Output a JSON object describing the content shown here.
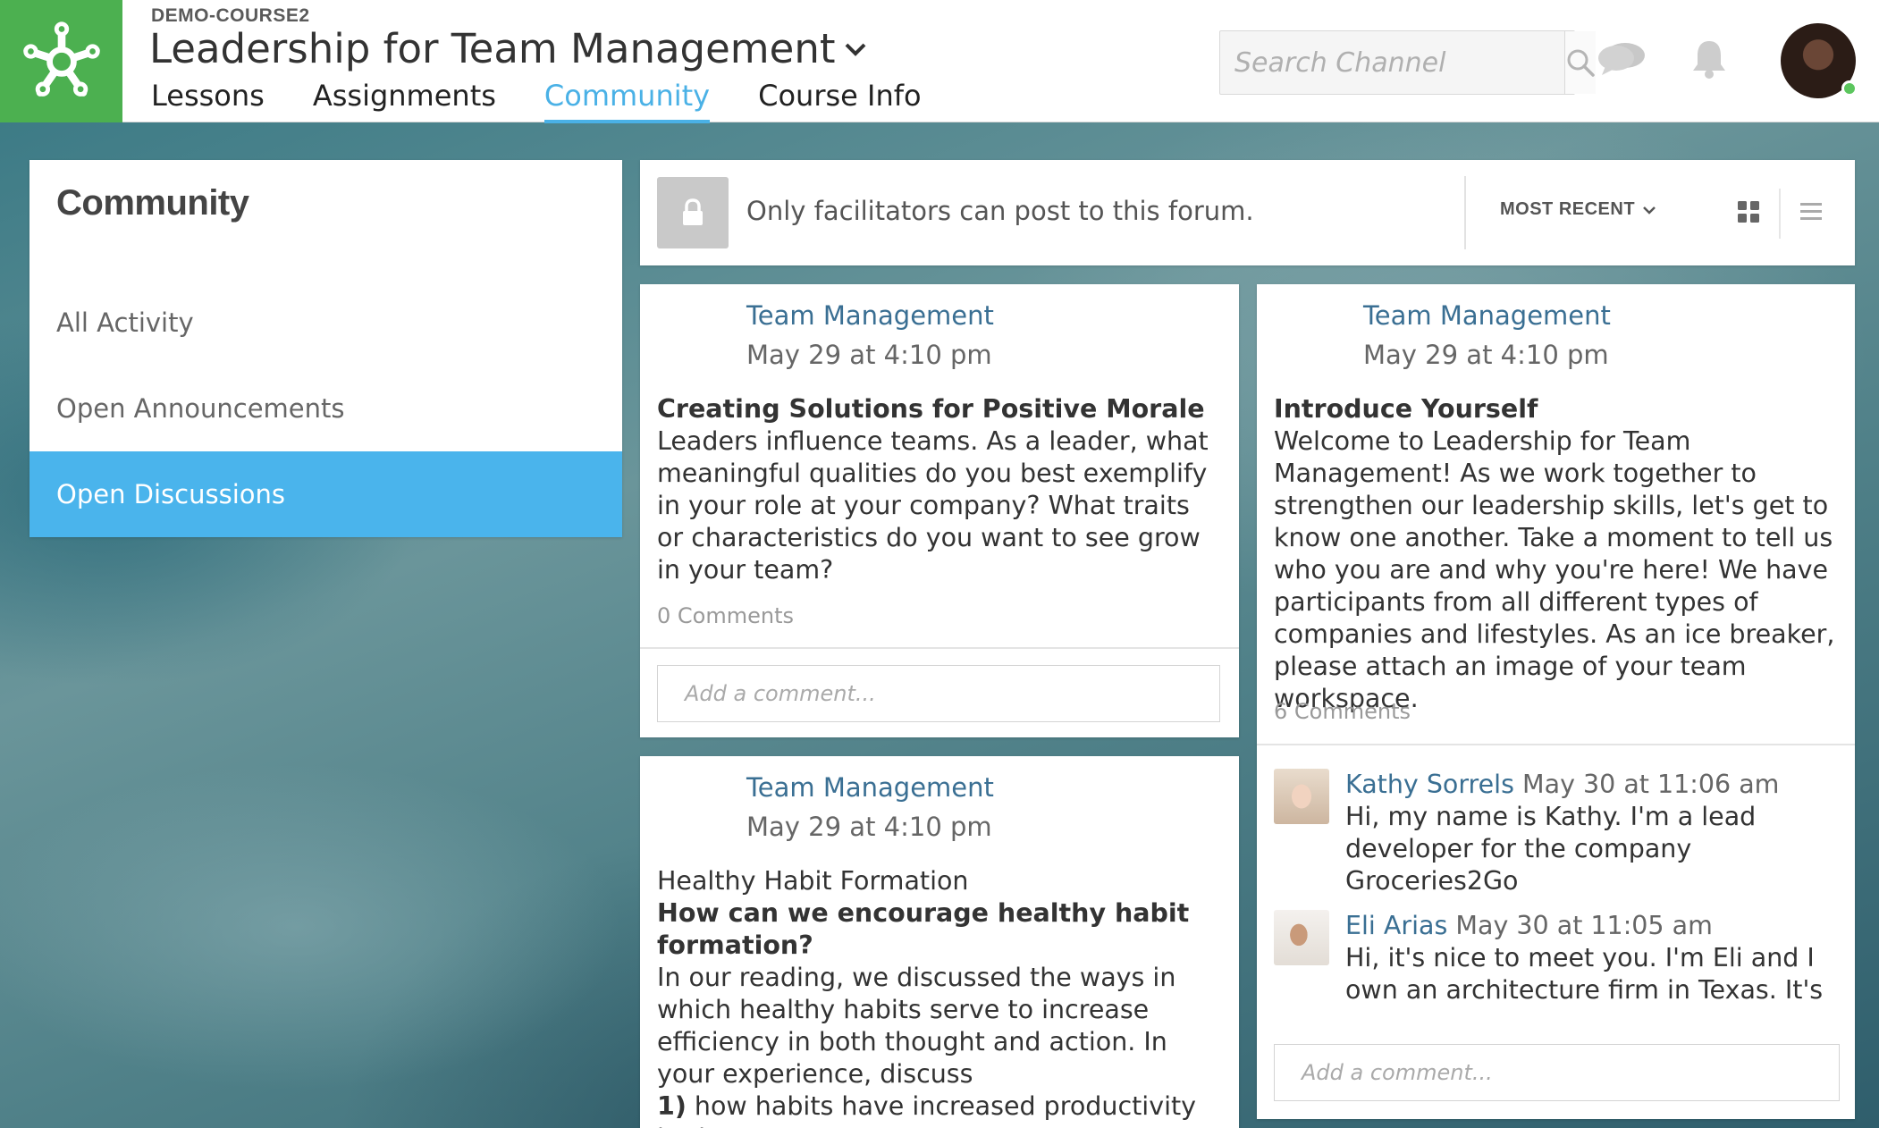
{
  "header": {
    "course_code": "DEMO-COURSE2",
    "course_title": "Leadership for Team Management",
    "nav": [
      {
        "label": "Lessons"
      },
      {
        "label": "Assignments"
      },
      {
        "label": "Community"
      },
      {
        "label": "Course Info"
      }
    ],
    "active_nav": "Community",
    "search_placeholder": "Search Channel"
  },
  "sidebar": {
    "title": "Community",
    "items": [
      {
        "label": "All Activity"
      },
      {
        "label": "Open Announcements"
      },
      {
        "label": "Open Discussions"
      }
    ],
    "active_item": "Open Discussions"
  },
  "topbar": {
    "notice": "Only facilitators can post to this forum.",
    "sort_label": "MOST RECENT"
  },
  "posts": [
    {
      "author": "Team Management",
      "date": "May 29 at 4:10 pm",
      "title": "Creating Solutions for Positive Morale",
      "body": "Leaders influence teams. As a leader, what meaningful qualities do you best exemplify in your role at your company? What traits or characteristics do you want to see grow in your team?",
      "comments_count": "0 Comments",
      "comment_placeholder": "Add a comment..."
    },
    {
      "author": "Team Management",
      "date": "May 29 at 4:10 pm",
      "title": "Healthy Habit Formation",
      "subtitle": "How can we encourage healthy habit formation?",
      "body": "In our reading, we discussed the ways in which healthy habits serve to increase efficiency in both thought and action. In your experience, discuss",
      "list_num": "1)",
      "list_text": "how habits have increased productivity in the"
    },
    {
      "author": "Team Management",
      "date": "May 29 at 4:10 pm",
      "title": "Introduce Yourself",
      "body": "Welcome to Leadership for Team Management! As we work together to strengthen our leadership skills, let's get to know one another. Take a moment to tell us who you are and why you're here! We have participants from all different types of companies and lifestyles. As an ice breaker, please attach an image of your team workspace.",
      "comments_count": "6 Comments",
      "comments": [
        {
          "name": "Kathy Sorrels",
          "date": "May 30 at 11:06 am",
          "text": "Hi, my name is Kathy. I'm a lead developer for the company Groceries2Go"
        },
        {
          "name": "Eli Arias",
          "date": "May 30 at 11:05 am",
          "text": "Hi, it's nice to meet you. I'm Eli and I own an architecture firm in Texas. It's"
        }
      ],
      "comment_placeholder": "Add a comment..."
    }
  ],
  "colors": {
    "brand_green": "#4cb050",
    "accent_blue": "#4ab1e6",
    "link_blue": "#3a6f93"
  }
}
